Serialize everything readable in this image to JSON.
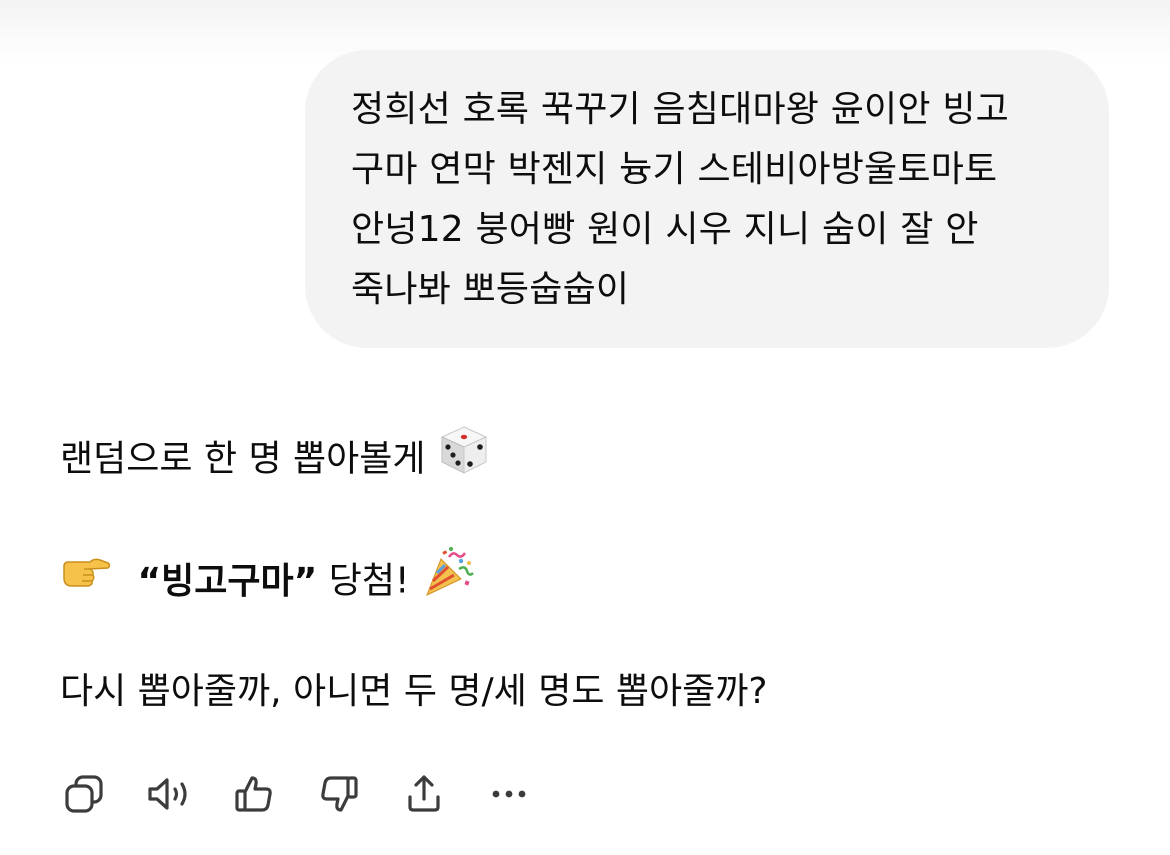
{
  "user_message": {
    "lines": [
      "정희선 호록 꾹꾸기 음침대마왕 윤이안 빙고",
      "구마 연막 박젠지 늉기 스테비아방울토마토",
      "안넝12 붕어빵 원이 시우 지니 숨이 잘 안",
      "죽나봐 뽀등숩숩이"
    ]
  },
  "assistant_reply": {
    "line1": "랜덤으로 한 명 뽑아볼게",
    "line1_emoji": "game-die",
    "line2_name": "“빙고구마”",
    "line2_rest": "당첨!",
    "line2_emoji_before": "backhand-index-pointing-right",
    "line2_emoji_after": "party-popper",
    "line3": "다시 뽑아줄까, 아니면 두 명/세 명도 뽑아줄까?"
  },
  "action_bar": {
    "icons": [
      "copy-icon",
      "read-aloud-icon",
      "thumbs-up-icon",
      "thumbs-down-icon",
      "share-icon",
      "more-icon"
    ]
  }
}
